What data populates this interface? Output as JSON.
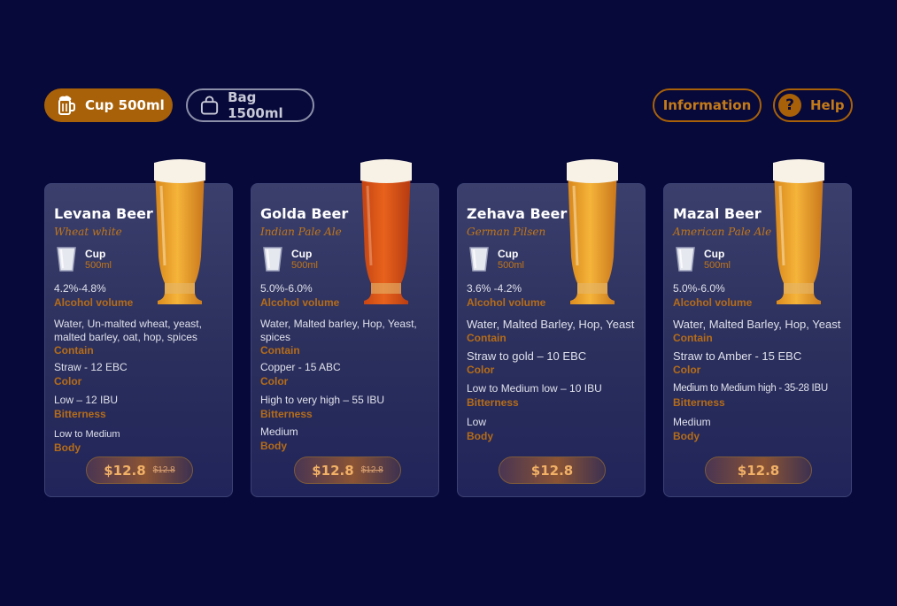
{
  "tabs": {
    "cup": {
      "label": "Cup 500ml"
    },
    "bag": {
      "label": "Bag 1500ml"
    }
  },
  "actions": {
    "information": "Information",
    "help": "Help",
    "help_glyph": "?"
  },
  "colors": {
    "background": "#07093a",
    "accent": "#a86108",
    "label": "#b56c18"
  },
  "beers": [
    {
      "name": "Levana Beer",
      "style": "Wheat white",
      "cup_label": "Cup",
      "cup_size": "500ml",
      "alcohol": "4.2%-4.8%",
      "alcohol_label": "Alcohol volume",
      "contain": "Water, Un-malted wheat, yeast, malted barley, oat, hop, spices",
      "contain_label": "Contain",
      "color": "Straw - 12 EBC",
      "color_label": "Color",
      "bitterness": "Low – 12 IBU",
      "bitterness_label": "Bitterness",
      "body": "Low to Medium",
      "body_label": "Body",
      "price": "$12.8",
      "old_price": "$12.8"
    },
    {
      "name": "Golda Beer",
      "style": "Indian Pale Ale",
      "cup_label": "Cup",
      "cup_size": "500ml",
      "alcohol": "5.0%-6.0%",
      "alcohol_label": "Alcohol volume",
      "contain": "Water, Malted barley, Hop, Yeast, spices",
      "contain_label": "Contain",
      "color": "Copper - 15 ABC",
      "color_label": "Color",
      "bitterness": "High to very high – 55 IBU",
      "bitterness_label": "Bitterness",
      "body": "Medium",
      "body_label": "Body",
      "price": "$12.8",
      "old_price": "$12.8"
    },
    {
      "name": "Zehava Beer",
      "style": "German Pilsen",
      "cup_label": "Cup",
      "cup_size": "500ml",
      "alcohol": "3.6% -4.2%",
      "alcohol_label": "Alcohol volume",
      "contain": "Water, Malted Barley, Hop, Yeast",
      "contain_label": "Contain",
      "color": "Straw to gold – 10 EBC",
      "color_label": "Color",
      "bitterness": "Low to Medium low – 10 IBU",
      "bitterness_label": "Bitterness",
      "body": "Low",
      "body_label": "Body",
      "price": "$12.8",
      "old_price": ""
    },
    {
      "name": "Mazal Beer",
      "style": "American Pale Ale",
      "cup_label": "Cup",
      "cup_size": "500ml",
      "alcohol": "5.0%-6.0%",
      "alcohol_label": "Alcohol volume",
      "contain": "Water, Malted Barley, Hop, Yeast",
      "contain_label": "Contain",
      "color": "Straw to Amber - 15 EBC",
      "color_label": "Color",
      "bitterness": "Medium to Medium high - 35-28 IBU",
      "bitterness_label": "Bitterness",
      "body": "Medium",
      "body_label": "Body",
      "price": "$12.8",
      "old_price": ""
    }
  ]
}
